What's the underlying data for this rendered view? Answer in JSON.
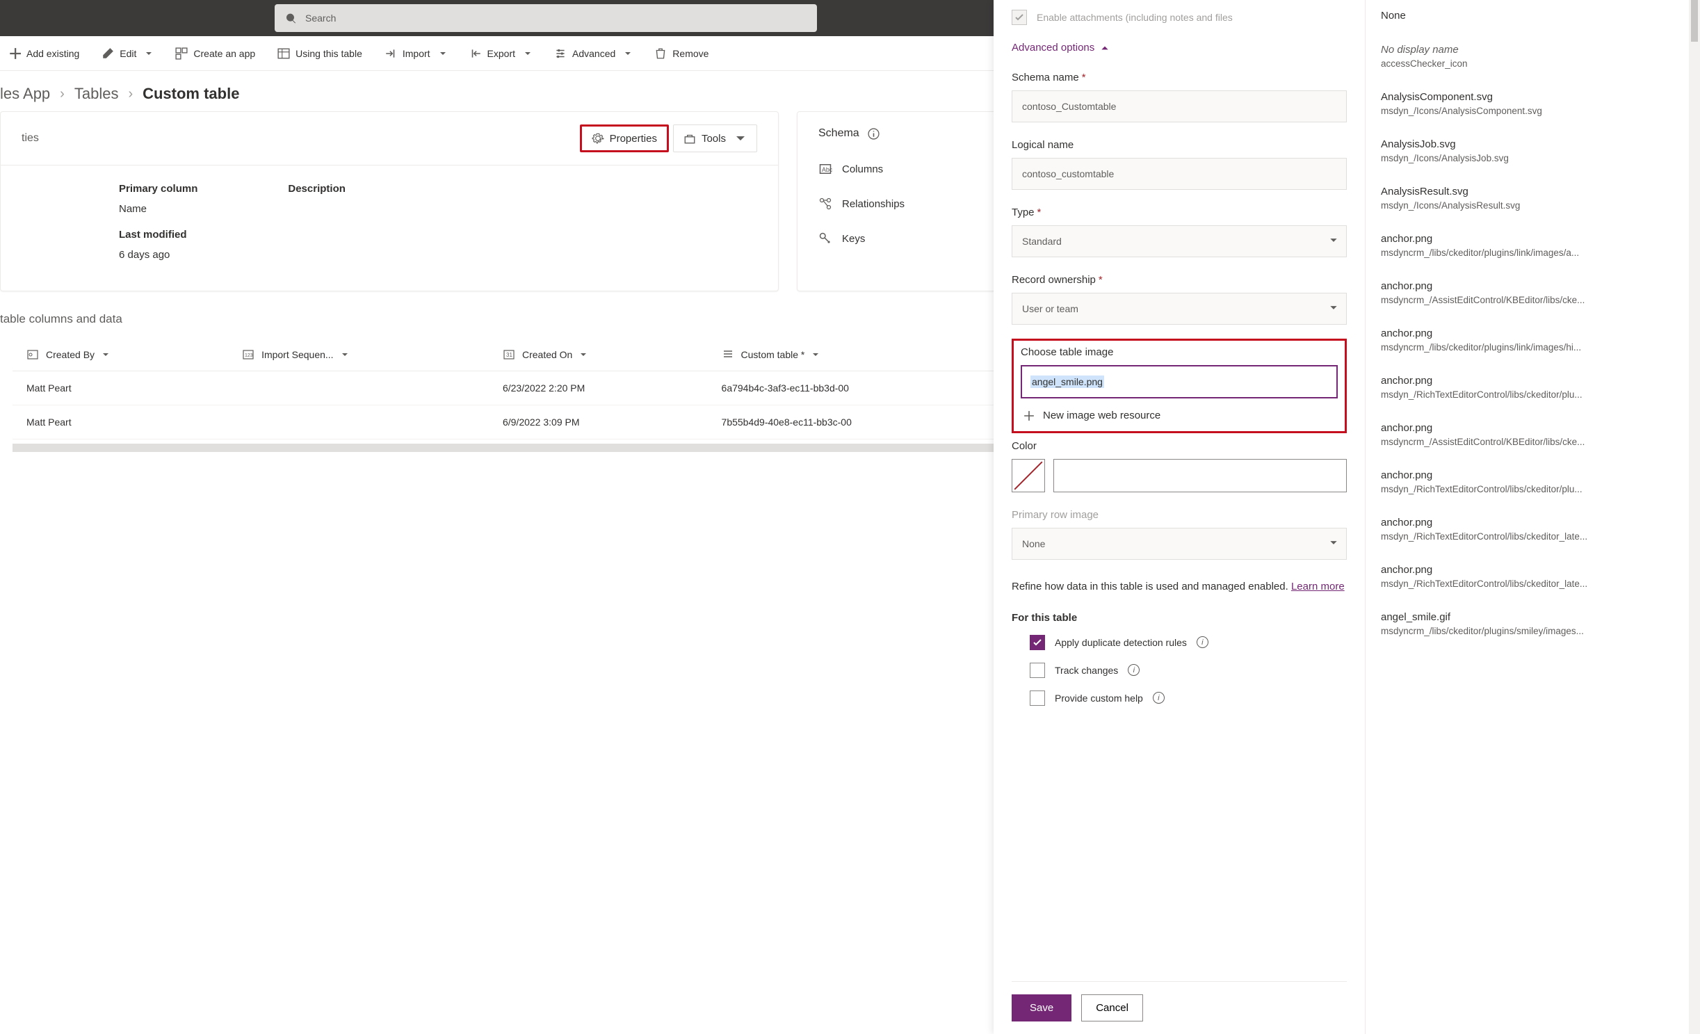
{
  "search": {
    "placeholder": "Search"
  },
  "command_bar": {
    "add_existing": "Add existing",
    "edit": "Edit",
    "create_app": "Create an app",
    "using_table": "Using this table",
    "import": "Import",
    "export": "Export",
    "advanced": "Advanced",
    "remove": "Remove"
  },
  "breadcrumb": {
    "app": "les App",
    "tables": "Tables",
    "current": "Custom table"
  },
  "card": {
    "properties_title": "ties",
    "properties_btn": "Properties",
    "tools_btn": "Tools",
    "schema_title": "Schema",
    "columns": "Columns",
    "relationships": "Relationships",
    "keys": "Keys",
    "primary_column_lbl": "Primary column",
    "primary_column_val": "Name",
    "last_modified_lbl": "Last modified",
    "last_modified_val": "6 days ago",
    "description_lbl": "Description"
  },
  "table_section": {
    "title": "table columns and data",
    "columns": [
      "Created By",
      "Import Sequen...",
      "Created On",
      "Custom table *"
    ],
    "required": [
      false,
      false,
      false,
      true
    ],
    "rows": [
      {
        "created_by": "Matt Peart",
        "import_seq": "",
        "created_on": "6/23/2022 2:20 PM",
        "custom_table": "6a794b4c-3af3-ec11-bb3d-00"
      },
      {
        "created_by": "Matt Peart",
        "import_seq": "",
        "created_on": "6/9/2022 3:09 PM",
        "custom_table": "7b55b4d9-40e8-ec11-bb3c-00"
      }
    ]
  },
  "panel": {
    "enable_attachments": "Enable attachments (including notes and files",
    "advanced_options": "Advanced options",
    "schema_name_lbl": "Schema name",
    "schema_name_val": "contoso_Customtable",
    "logical_name_lbl": "Logical name",
    "logical_name_val": "contoso_customtable",
    "type_lbl": "Type",
    "type_val": "Standard",
    "record_ownership_lbl": "Record ownership",
    "record_ownership_val": "User or team",
    "choose_image_lbl": "Choose table image",
    "choose_image_val": "angel_smile.png",
    "new_image": "New image web resource",
    "color_lbl": "Color",
    "primary_row_image_lbl": "Primary row image",
    "primary_row_image_val": "None",
    "refine_text": "Refine how data in this table is used and managed enabled.",
    "learn_more": "Learn more",
    "for_this_table": "For this table",
    "apply_dup": "Apply duplicate detection rules",
    "track_changes": "Track changes",
    "custom_help": "Provide custom help",
    "save": "Save",
    "cancel": "Cancel"
  },
  "dropdown": [
    {
      "name": "None",
      "path": ""
    },
    {
      "name": "No display name",
      "italic": true,
      "path": "accessChecker_icon"
    },
    {
      "name": "AnalysisComponent.svg",
      "path": "msdyn_/Icons/AnalysisComponent.svg"
    },
    {
      "name": "AnalysisJob.svg",
      "path": "msdyn_/Icons/AnalysisJob.svg"
    },
    {
      "name": "AnalysisResult.svg",
      "path": "msdyn_/Icons/AnalysisResult.svg"
    },
    {
      "name": "anchor.png",
      "path": "msdyncrm_/libs/ckeditor/plugins/link/images/a..."
    },
    {
      "name": "anchor.png",
      "path": "msdyncrm_/AssistEditControl/KBEditor/libs/cke..."
    },
    {
      "name": "anchor.png",
      "path": "msdyncrm_/libs/ckeditor/plugins/link/images/hi..."
    },
    {
      "name": "anchor.png",
      "path": "msdyn_/RichTextEditorControl/libs/ckeditor/plu..."
    },
    {
      "name": "anchor.png",
      "path": "msdyncrm_/AssistEditControl/KBEditor/libs/cke..."
    },
    {
      "name": "anchor.png",
      "path": "msdyn_/RichTextEditorControl/libs/ckeditor/plu..."
    },
    {
      "name": "anchor.png",
      "path": "msdyn_/RichTextEditorControl/libs/ckeditor_late..."
    },
    {
      "name": "anchor.png",
      "path": "msdyn_/RichTextEditorControl/libs/ckeditor_late..."
    },
    {
      "name": "angel_smile.gif",
      "path": "msdyncrm_/libs/ckeditor/plugins/smiley/images..."
    }
  ]
}
